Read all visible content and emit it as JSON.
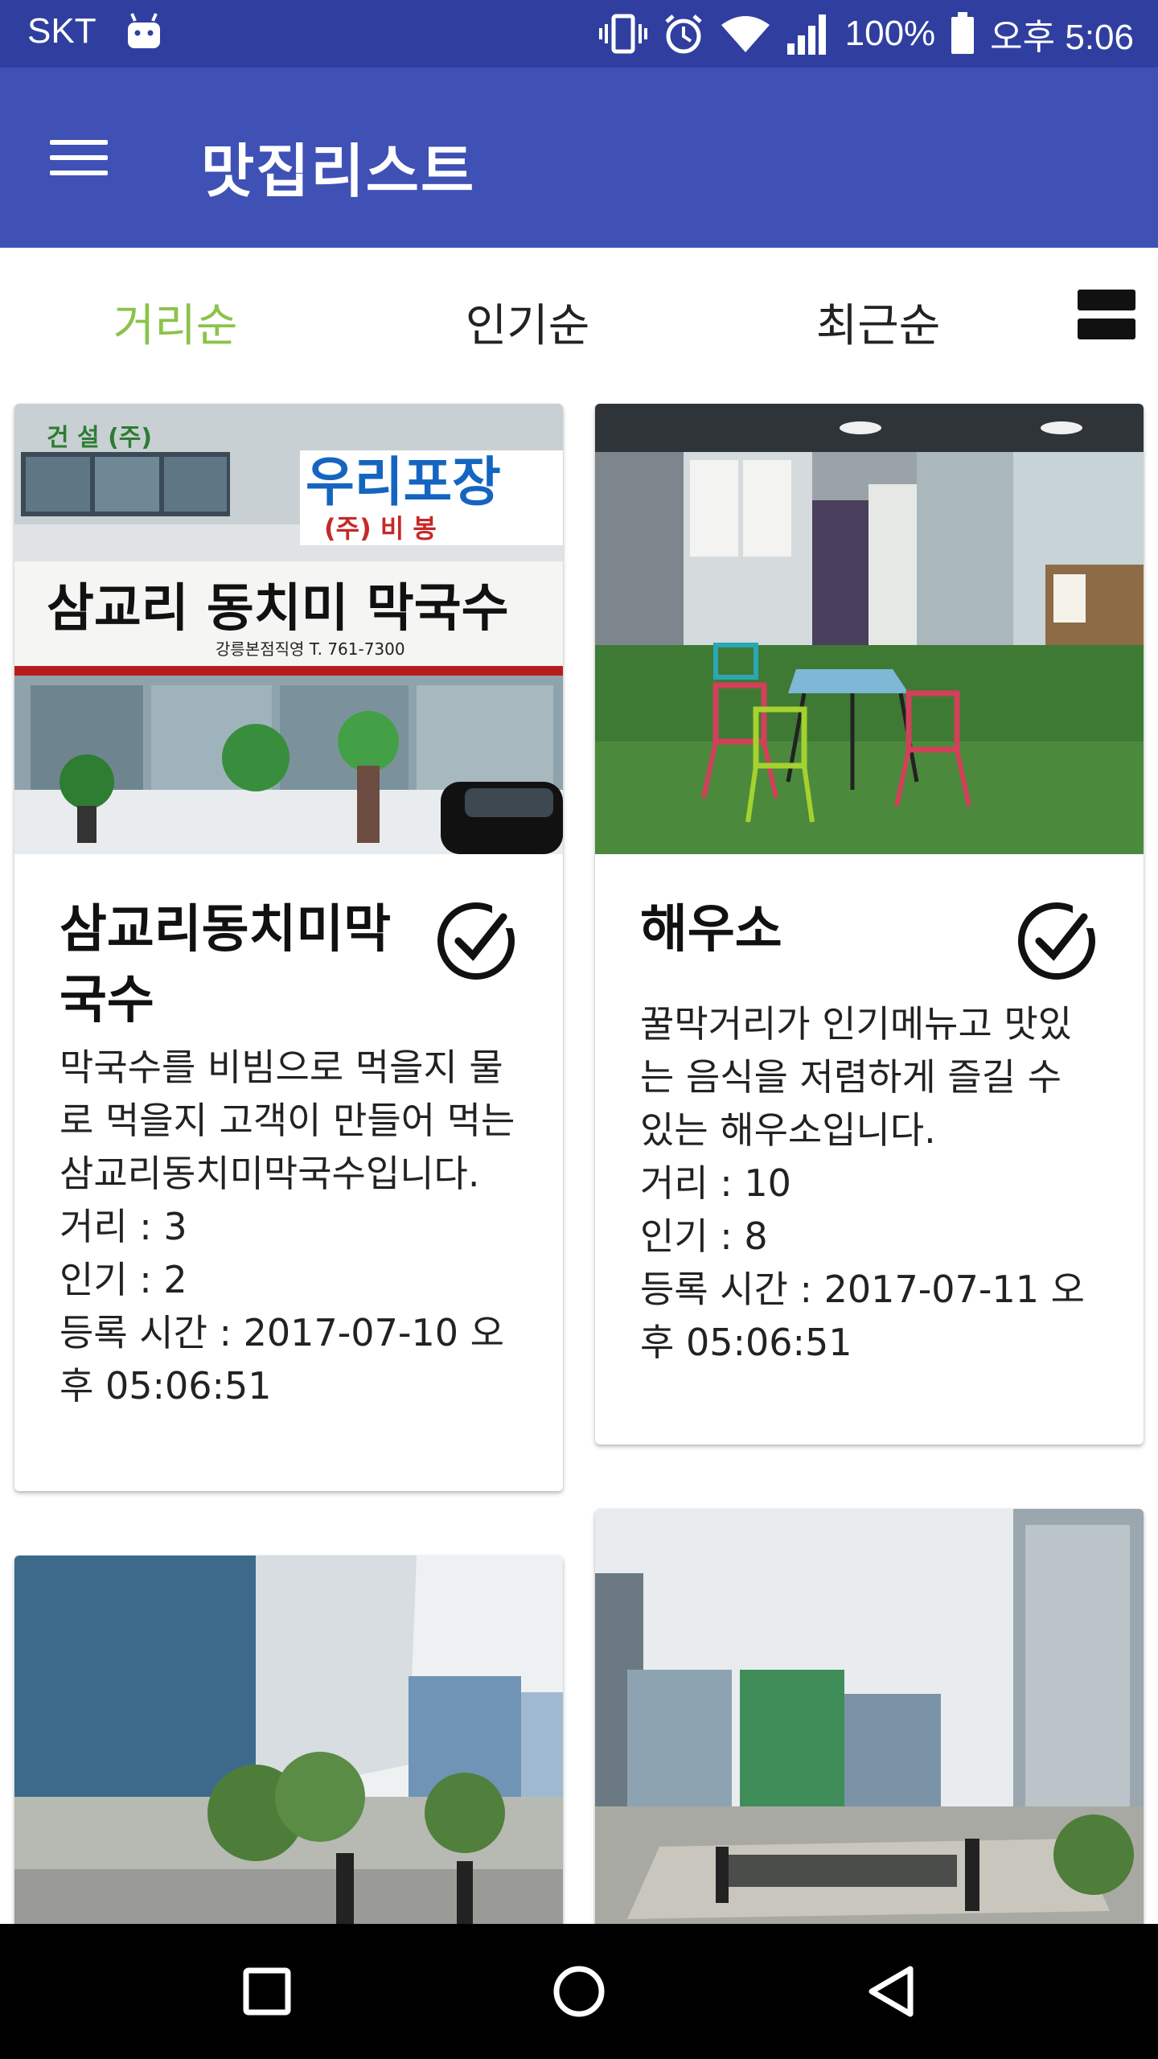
{
  "status_bar": {
    "carrier": "SKT",
    "battery_percent": "100%",
    "time": "오후 5:06",
    "icons": [
      "android-icon",
      "vibrate-icon",
      "alarm-icon",
      "wifi-icon",
      "signal-icon",
      "battery-icon"
    ]
  },
  "app_bar": {
    "title": "맛집리스트",
    "menu_icon": "hamburger-menu-icon"
  },
  "sort_tabs": {
    "distance": "거리순",
    "popular": "인기순",
    "recent": "최근순",
    "active": "distance",
    "active_color": "#8bc34a",
    "view_toggle_icon": "view-list-icon"
  },
  "colors": {
    "status_bar": "#303f9f",
    "primary": "#3f51b5",
    "accent": "#8bc34a"
  },
  "restaurants": [
    {
      "name": "삼교리동치미막국수",
      "description": "막국수를 비빔으로 먹을지 물로 먹을지 고객이 만들어 먹는 삼교리동치미막국수입니다.",
      "distance": "거리 : 3",
      "popularity": "인기 : 2",
      "registered": "등록 시간 : 2017-07-10 오후 05:06:51",
      "photo": {
        "sign_company": "건 설 (주)",
        "sign_main": "우리포장",
        "sign_sub": "(주) 비 봉",
        "banner": "삼교리 동치미 막국수",
        "banner_small": "강릉본점직영 T. 761-7300"
      }
    },
    {
      "name": "해우소",
      "description": "꿀막거리가 인기메뉴고 맛있는 음식을 저렴하게 즐길 수 있는 해우소입니다.",
      "distance": "거리 : 10",
      "popularity": "인기 : 8",
      "registered": "등록 시간 : 2017-07-11 오후 05:06:51"
    },
    {},
    {}
  ]
}
